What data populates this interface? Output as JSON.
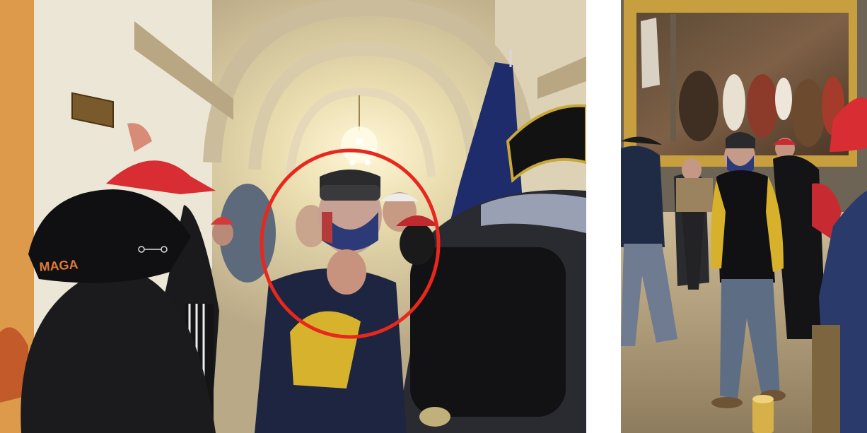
{
  "left_photo": {
    "sign_text": "",
    "cap_text": "MAGA",
    "highlight_color": "#e8281c"
  },
  "right_photo": {}
}
